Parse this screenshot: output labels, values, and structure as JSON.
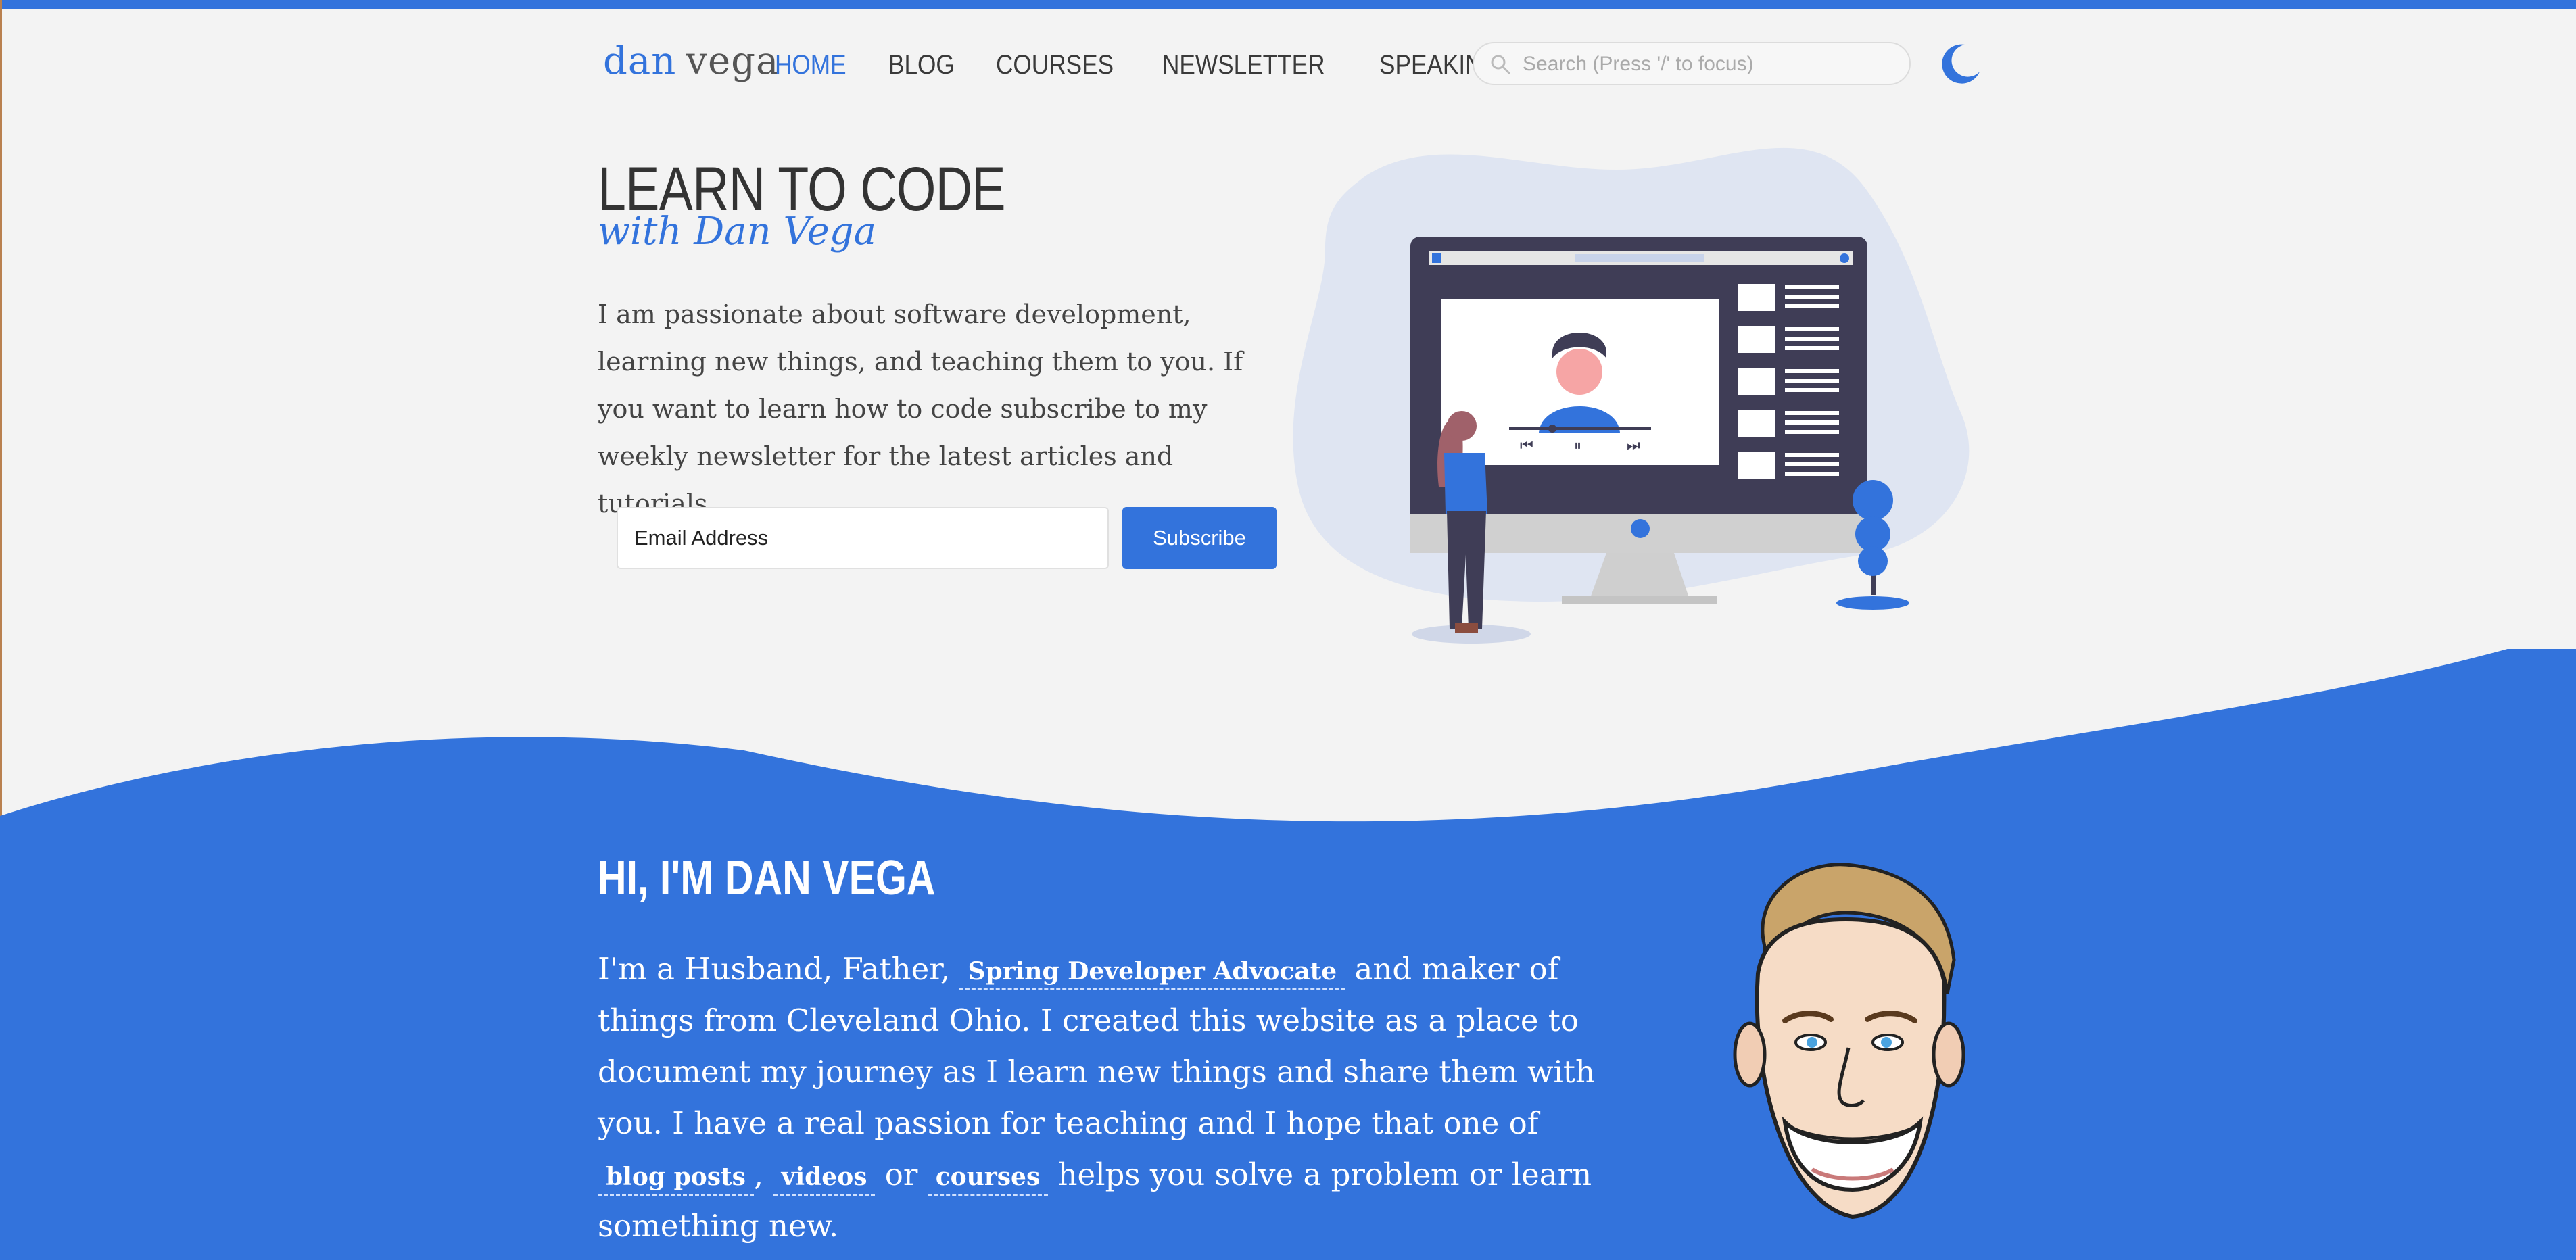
{
  "brand": {
    "first": "dan",
    "last": "vega"
  },
  "nav": {
    "items": [
      {
        "label": "HOME",
        "active": true
      },
      {
        "label": "BLOG",
        "active": false
      },
      {
        "label": "COURSES",
        "active": false
      },
      {
        "label": "NEWSLETTER",
        "active": false
      },
      {
        "label": "SPEAKING",
        "active": false
      }
    ]
  },
  "search": {
    "placeholder": "Search (Press '/' to focus)"
  },
  "hero": {
    "title": "LEARN TO CODE",
    "subtitle": "with Dan Vega",
    "description": "I am passionate about software development, learning new things, and teaching them to you. If you want to learn how to code subscribe to my weekly newsletter for the latest articles and tutorials.",
    "email_placeholder": "Email Address",
    "subscribe_label": "Subscribe"
  },
  "about": {
    "title": "HI, I'M DAN VEGA",
    "part1": "I'm a Husband, Father, ",
    "link_role": "Spring Developer Advocate",
    "part2": " and maker of things from Cleveland Ohio. I created this website as a place to document my journey as I learn new things and share them with you. I have a real passion for teaching and I hope that one of ",
    "link_blog": "blog posts",
    "sep1": ", ",
    "link_videos": "videos",
    "sep2": " or ",
    "link_courses": "courses",
    "part3": " helps you solve a problem or learn something new."
  },
  "colors": {
    "accent": "#3373dc",
    "background": "#f3f3f3",
    "text": "#333333"
  },
  "icons": {
    "search": "search-icon",
    "theme": "moon-icon"
  }
}
